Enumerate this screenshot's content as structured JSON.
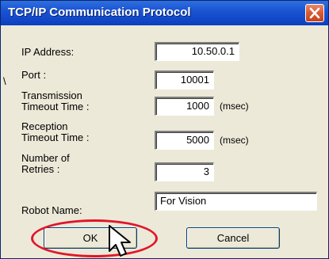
{
  "window": {
    "title": "TCP/IP Communication Protocol",
    "close_icon": "close-icon",
    "accent": "#1a54d3",
    "close_color": "#d75a33"
  },
  "fields": {
    "ip_address": {
      "label": "IP Address:",
      "value": "10.50.0.1"
    },
    "port": {
      "label": "Port :",
      "value": "10001"
    },
    "transmission_timeout": {
      "label": "Transmission\nTimeout Time :",
      "value": "1000",
      "unit": "(msec)"
    },
    "reception_timeout": {
      "label": "Reception\nTimeout Time :",
      "value": "5000",
      "unit": "(msec)"
    },
    "retries": {
      "label": "Number of\nRetries :",
      "value": "3"
    },
    "robot_name": {
      "label": "Robot Name:",
      "value": "For Vision"
    }
  },
  "buttons": {
    "ok_label": "OK",
    "cancel_label": "Cancel"
  },
  "annotation": {
    "highlight_color": "#e0162b",
    "pointer_icon": "mouse-pointer-icon"
  }
}
